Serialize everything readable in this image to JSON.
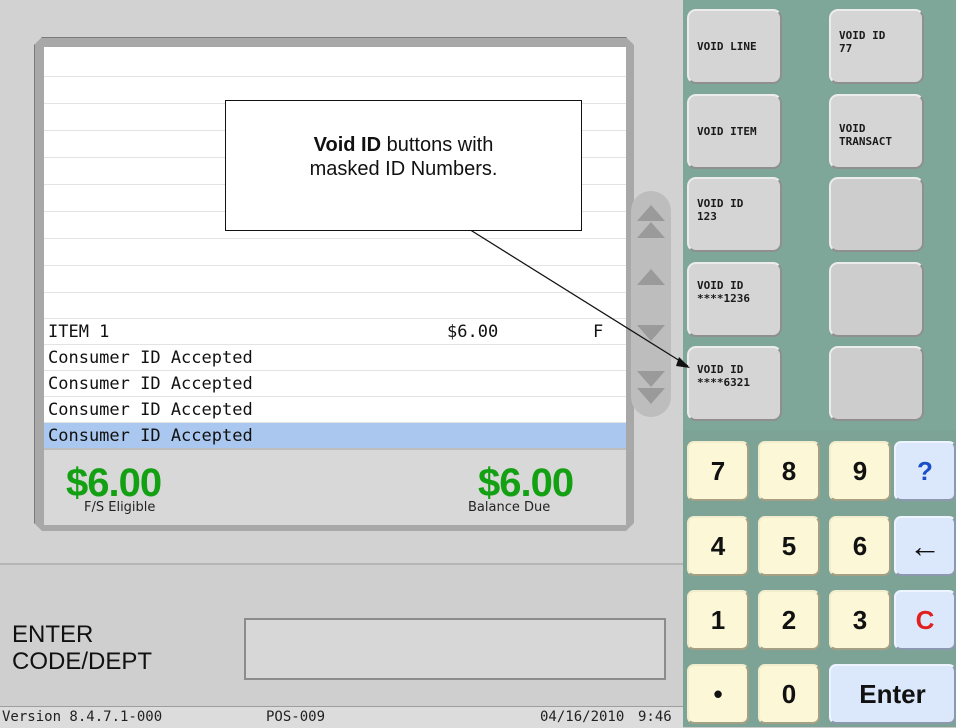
{
  "receipt": {
    "lines": [
      {
        "desc": "ITEM 1",
        "price": "$6.00",
        "flag": "F"
      },
      {
        "desc": "Consumer ID Accepted",
        "price": "",
        "flag": ""
      },
      {
        "desc": "Consumer ID Accepted",
        "price": "",
        "flag": ""
      },
      {
        "desc": "Consumer ID Accepted",
        "price": "",
        "flag": ""
      },
      {
        "desc": "Consumer ID Accepted",
        "price": "",
        "flag": ""
      }
    ],
    "fs_eligible_amount": "$6.00",
    "fs_eligible_label": "F/S Eligible",
    "balance_due_amount": "$6.00",
    "balance_due_label": "Balance Due"
  },
  "entry": {
    "prompt": "ENTER\nCODE/DEPT",
    "value": ""
  },
  "status_bar": {
    "version": "Version  8.4.7.1-000",
    "terminal": "POS-009",
    "date": "04/16/2010",
    "time": "9:46"
  },
  "function_buttons": [
    {
      "label": "VOID LINE"
    },
    {
      "label": "VOID ID\n77"
    },
    {
      "label": "VOID ITEM"
    },
    {
      "label": "VOID\nTRANSACT"
    },
    {
      "label": "VOID ID\n123"
    },
    {
      "label": ""
    },
    {
      "label": "VOID ID\n****1236"
    },
    {
      "label": ""
    },
    {
      "label": "VOID ID\n****6321"
    },
    {
      "label": ""
    }
  ],
  "keypad": {
    "k7": "7",
    "k8": "8",
    "k9": "9",
    "help": "?",
    "k4": "4",
    "k5": "5",
    "k6": "6",
    "back": "←",
    "k1": "1",
    "k2": "2",
    "k3": "3",
    "clear": "C",
    "dot": "•",
    "k0": "0",
    "enter": "Enter"
  },
  "colors": {
    "amount_green": "#13a013",
    "clear_red": "#e02020",
    "selected_row": "#a9c7ef",
    "right_panel_bg": "#7ea79a"
  },
  "callout": {
    "bold_text": "Void ID",
    "text_rest": " buttons with\nmasked ID Numbers."
  }
}
